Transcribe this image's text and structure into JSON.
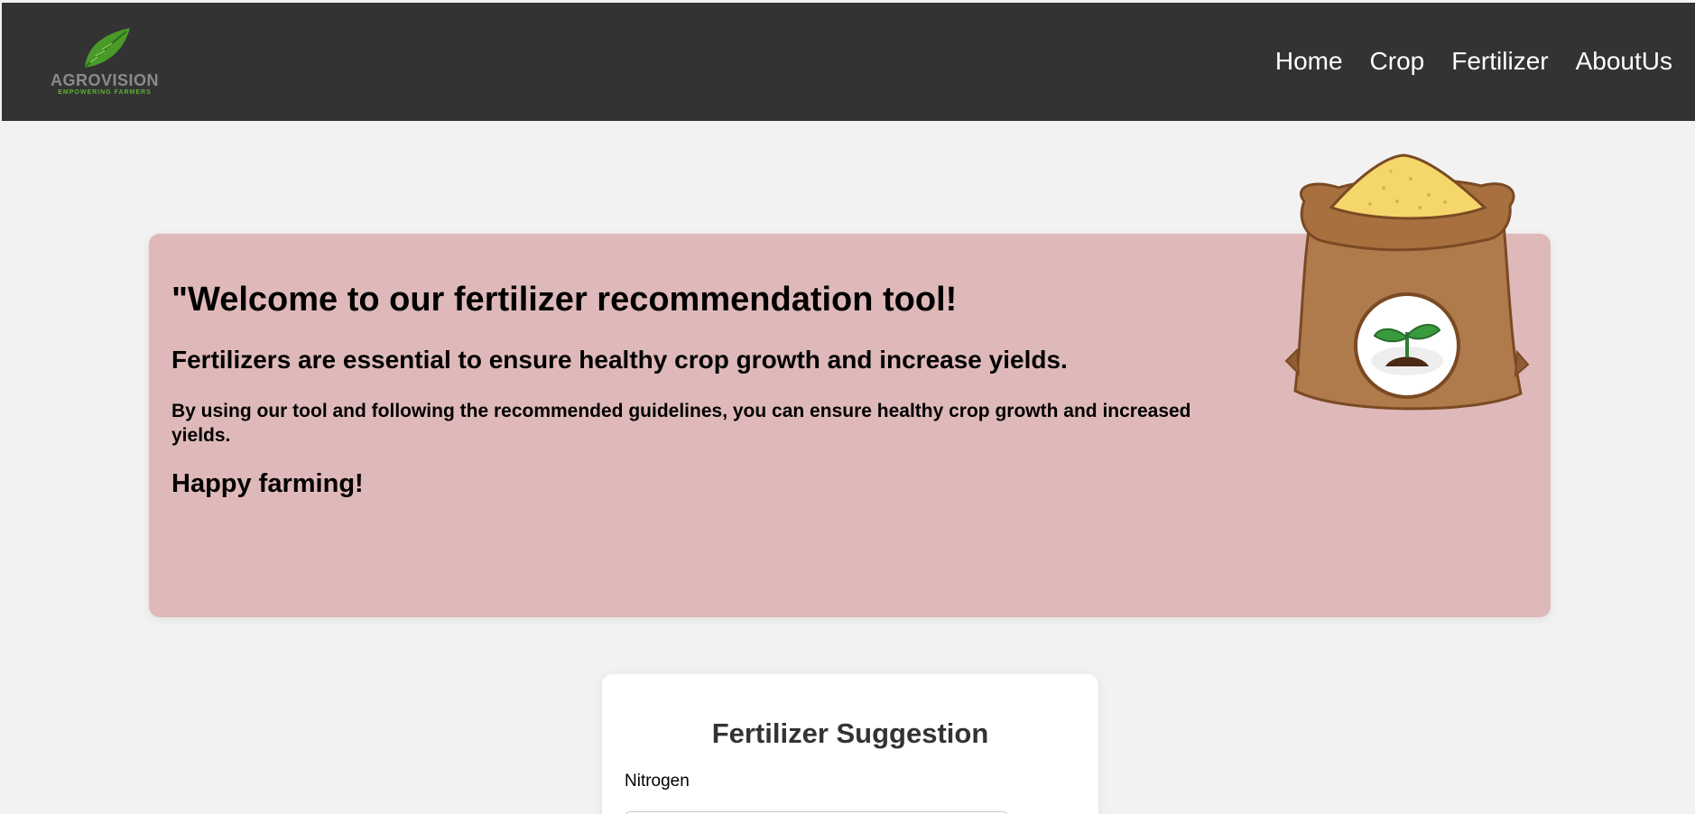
{
  "header": {
    "logo": {
      "brand": "AGROVISION",
      "tagline": "EMPOWERING FARMERS",
      "icon": "leaf-icon"
    },
    "nav": [
      "Home",
      "Crop",
      "Fertilizer",
      "AboutUs"
    ]
  },
  "hero": {
    "title": "\"Welcome to our fertilizer recommendation tool!",
    "subtitle": "Fertilizers are essential to ensure healthy crop growth and increase yields.",
    "body": "By using our tool and following the recommended guidelines, you can ensure healthy crop growth and increased yields.",
    "closing": "Happy farming!",
    "illustration": "fertilizer-sack-icon"
  },
  "form": {
    "title": "Fertilizer Suggestion",
    "fields": [
      {
        "label": "Nitrogen",
        "value": ""
      }
    ]
  },
  "colors": {
    "header_bg": "#333333",
    "page_bg": "#f2f2f2",
    "hero_bg": "#dfb9b9",
    "card_bg": "#ffffff",
    "accent_green": "#5fb233"
  }
}
